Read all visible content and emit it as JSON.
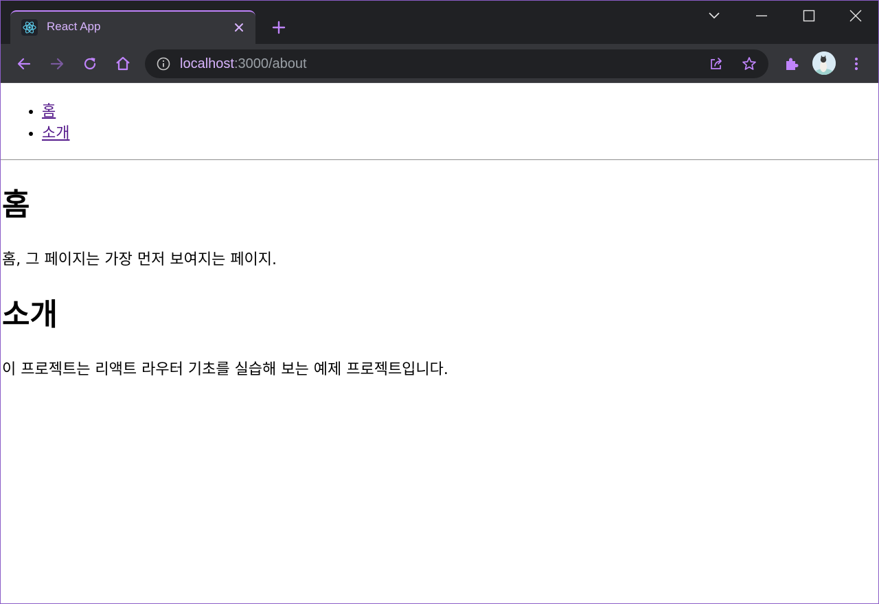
{
  "browser": {
    "tab": {
      "title": "React App",
      "favicon": "react-logo-icon"
    },
    "address": {
      "host": "localhost",
      "rest": ":3000/about"
    },
    "accent_color": "#c084fc",
    "toolbar_icons": [
      "back-icon",
      "forward-icon",
      "reload-icon",
      "home-icon",
      "info-icon",
      "share-icon",
      "star-icon",
      "extensions-icon",
      "avatar",
      "menu-icon"
    ],
    "window_controls": [
      "tab-search-icon",
      "minimize-icon",
      "maximize-icon",
      "close-icon"
    ]
  },
  "page": {
    "nav": {
      "items": [
        {
          "label": "홈"
        },
        {
          "label": "소개"
        }
      ]
    },
    "home": {
      "heading": "홈",
      "text": "홈, 그 페이지는 가장 먼저 보여지는 페이지."
    },
    "about": {
      "heading": "소개",
      "text": "이 프로젝트는 리액트 라우터 기초를 실습해 보는 예제 프로젝트입니다."
    }
  }
}
